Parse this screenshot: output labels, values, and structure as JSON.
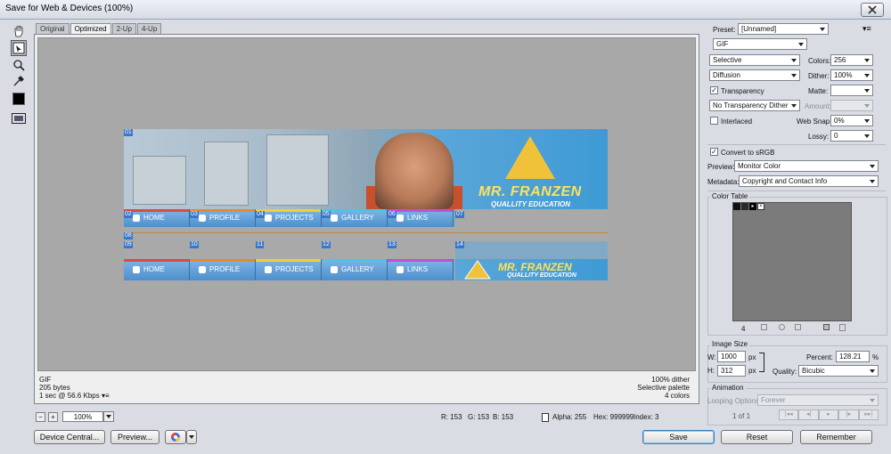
{
  "window": {
    "title": "Save for Web & Devices (100%)"
  },
  "tabs": [
    "Original",
    "Optimized",
    "2-Up",
    "4-Up"
  ],
  "banner": {
    "brand": "MR. FRANZEN",
    "tagline": "QUALLITY EDUCATION",
    "nav_items": [
      "HOME",
      "PROFILE",
      "PROJECTS",
      "GALLERY",
      "LINKS"
    ],
    "nav_colors": [
      "#e04a3a",
      "#e8892c",
      "#f0d12e",
      "#4cc4e8",
      "#c24fd6"
    ],
    "slice_row1": [
      "02",
      "03",
      "04",
      "05",
      "06",
      "07"
    ],
    "slice_row2": [
      "09",
      "10",
      "11",
      "12",
      "13",
      "14"
    ],
    "slice_top": "01",
    "slice_mid": "08"
  },
  "info_left": {
    "format": "GIF",
    "size": "205 bytes",
    "speed": "1 sec @ 56.6 Kbps"
  },
  "info_right": {
    "dither": "100% dither",
    "palette": "Selective palette",
    "colors": "4 colors"
  },
  "status": {
    "zoom": "100%",
    "r": "R: 153",
    "g": "G: 153",
    "b": "B: 153",
    "alpha": "Alpha: 255",
    "hex": "Hex: 999999",
    "index": "Index: 3"
  },
  "buttons": {
    "device_central": "Device Central...",
    "preview": "Preview...",
    "save": "Save",
    "reset": "Reset",
    "remember": "Remember"
  },
  "settings": {
    "preset_label": "Preset:",
    "preset_value": "[Unnamed]",
    "format": "GIF",
    "reduction": "Selective",
    "colors_label": "Colors:",
    "colors_value": "256",
    "dither_algo": "Diffusion",
    "dither_label": "Dither:",
    "dither_value": "100%",
    "transparency_label": "Transparency",
    "matte_label": "Matte:",
    "trans_dither": "No Transparency Dither",
    "amount_label": "Amount:",
    "interlaced_label": "Interlaced",
    "websnap_label": "Web Snap:",
    "websnap_value": "0%",
    "lossy_label": "Lossy:",
    "lossy_value": "0",
    "srgb_label": "Convert to sRGB",
    "preview_label": "Preview:",
    "preview_value": "Monitor Color",
    "metadata_label": "Metadata:",
    "metadata_value": "Copyright and Contact Info"
  },
  "color_table": {
    "title": "Color Table",
    "count": "4"
  },
  "image_size": {
    "title": "Image Size",
    "w_label": "W:",
    "w_value": "1000",
    "h_label": "H:",
    "h_value": "312",
    "unit": "px",
    "percent_label": "Percent:",
    "percent_value": "128.21",
    "percent_unit": "%",
    "quality_label": "Quality:",
    "quality_value": "Bicubic"
  },
  "animation": {
    "title": "Animation",
    "looping_label": "Looping Options:",
    "looping_value": "Forever",
    "frame": "1 of 1"
  }
}
